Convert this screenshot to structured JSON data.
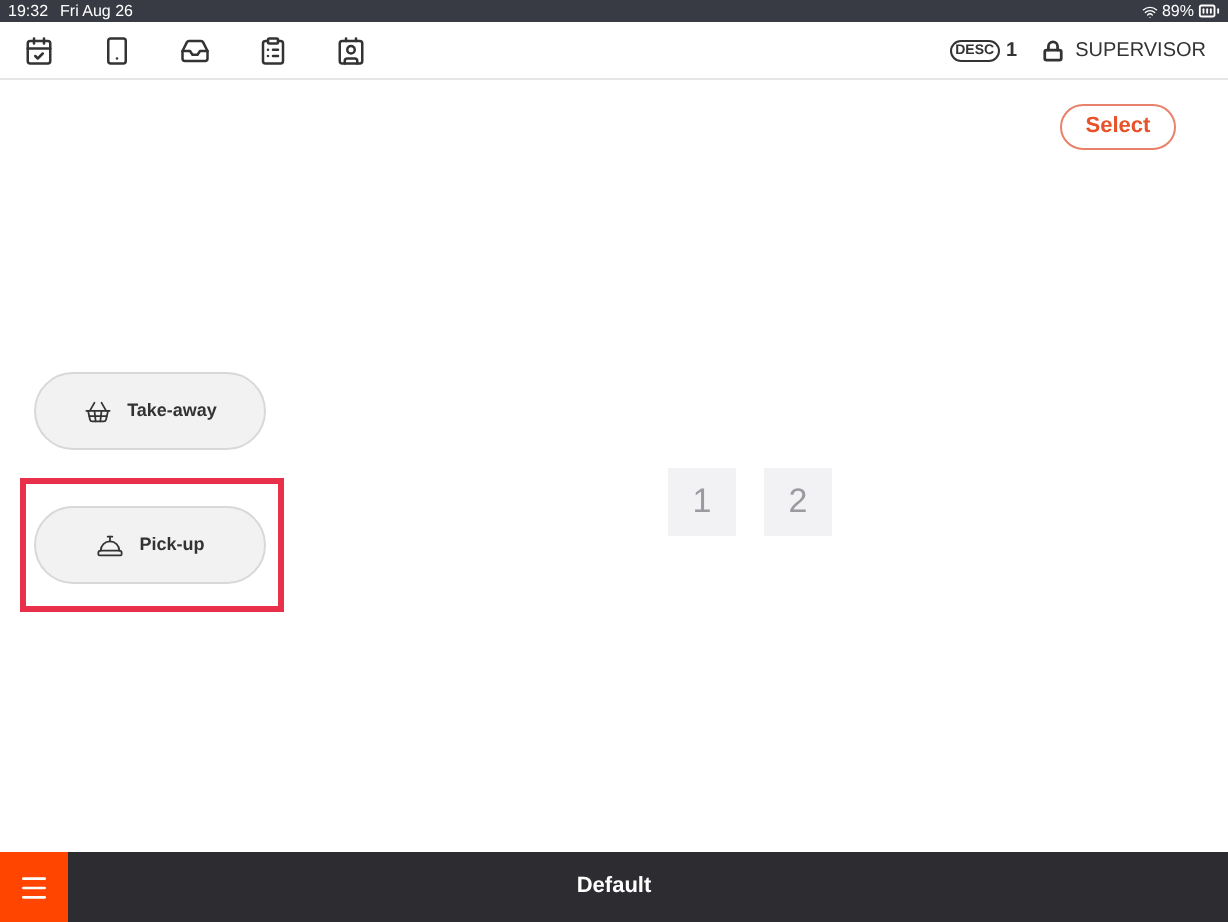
{
  "status_bar": {
    "time": "19:32",
    "date": "Fri Aug 26",
    "battery": "89%"
  },
  "toolbar": {
    "icons": [
      {
        "kind": "calendar"
      },
      {
        "kind": "tablet"
      },
      {
        "kind": "cash-tray"
      },
      {
        "kind": "clipboard"
      },
      {
        "kind": "contact"
      }
    ],
    "badge": "DESC",
    "badge_count": "1",
    "user": "SUPERVISOR"
  },
  "select_button": "Select",
  "order_types": [
    {
      "label": "Take-away",
      "kind": "basket",
      "highlighted": false
    },
    {
      "label": "Pick-up",
      "kind": "bell",
      "highlighted": true
    }
  ],
  "tables": [
    "1",
    "2"
  ],
  "footer": {
    "title": "Default"
  }
}
